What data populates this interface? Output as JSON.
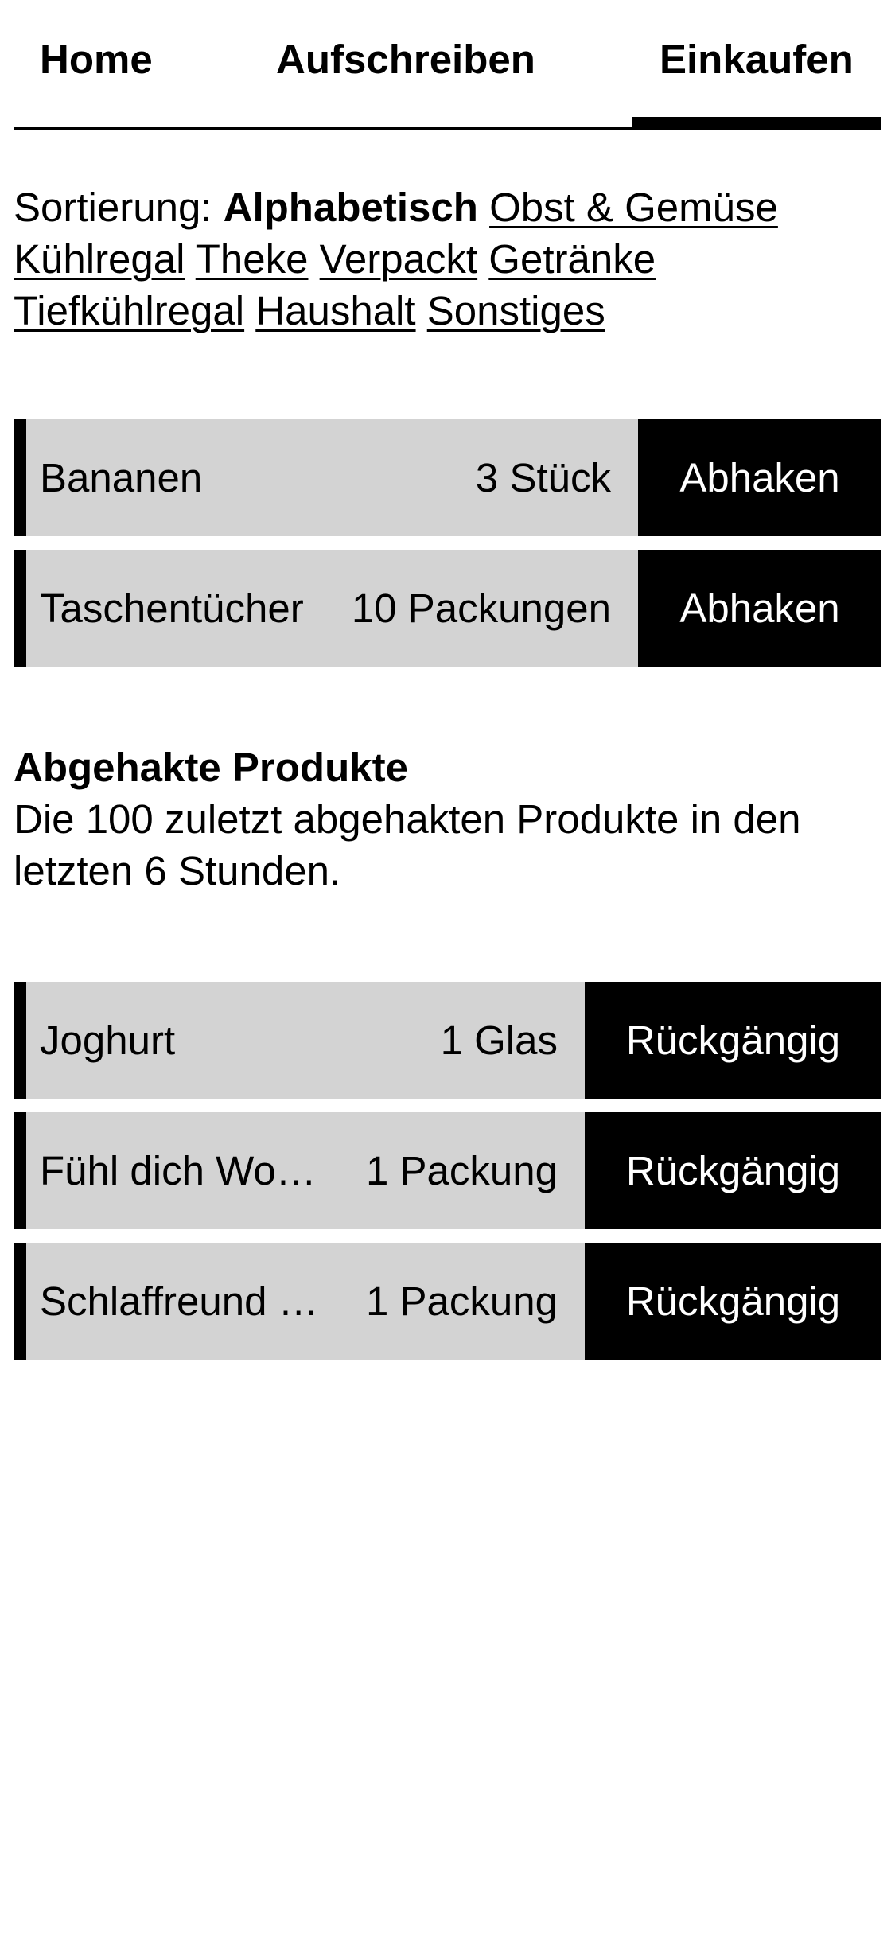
{
  "nav": {
    "tabs": [
      {
        "label": "Home"
      },
      {
        "label": "Aufschreiben"
      },
      {
        "label": "Einkaufen"
      }
    ]
  },
  "sorting": {
    "label": "Sortierung:",
    "active": "Alphabetisch",
    "options": [
      "Obst & Gemüse",
      "Kühlregal",
      "Theke",
      "Verpackt",
      "Getränke",
      "Tiefkühlregal",
      "Haushalt",
      "Sonstiges"
    ]
  },
  "shopping_list": {
    "items": [
      {
        "name": "Bananen",
        "quantity": "3 Stück",
        "action": "Abhaken"
      },
      {
        "name": "Taschentücher",
        "quantity": "10 Packungen",
        "action": "Abhaken"
      }
    ]
  },
  "checked": {
    "title": "Abgehakte Produkte",
    "description": "Die 100 zuletzt abgehakten Produkte in den letzten 6 Stunden.",
    "items": [
      {
        "name": "Joghurt",
        "quantity": "1 Glas",
        "action": "Rückgängig"
      },
      {
        "name": "Fühl dich Wo…",
        "quantity": "1 Packung",
        "action": "Rückgängig"
      },
      {
        "name": "Schlaffreund …",
        "quantity": "1 Packung",
        "action": "Rückgängig"
      }
    ]
  }
}
